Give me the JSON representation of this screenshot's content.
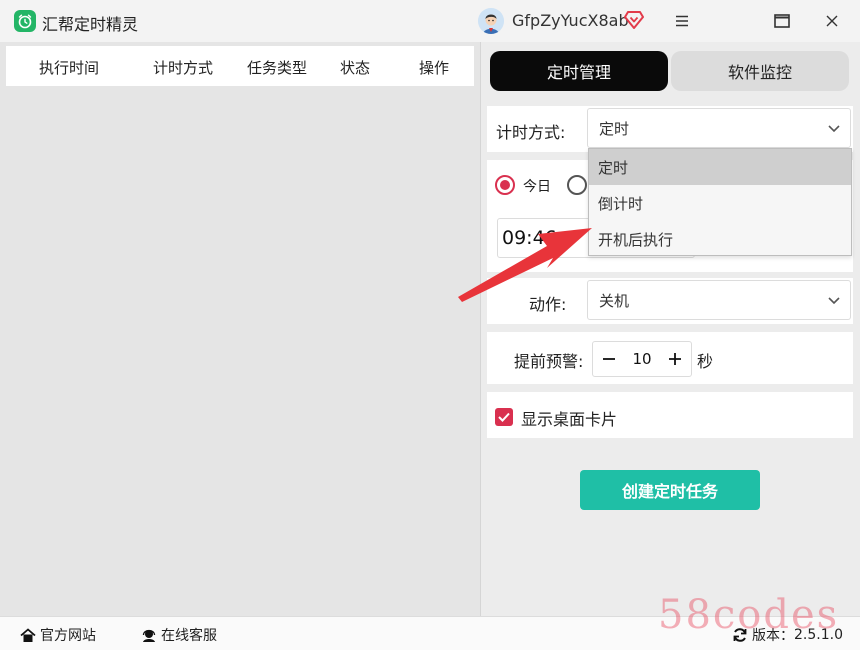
{
  "app": {
    "title": "汇帮定时精灵",
    "username": "GfpZyYucX8ab"
  },
  "colors": {
    "accent_red": "#d9304f",
    "brand_green": "#23b566",
    "create_teal": "#1fbfa6",
    "active_tab": "#0a0a0a",
    "arrow_red": "#e8343a"
  },
  "icons": {
    "logo": "alarm-clock-icon",
    "vip": "diamond-icon",
    "menu": "hamburger-menu-icon",
    "maximize": "maximize-icon",
    "close": "close-icon",
    "home": "home-icon",
    "support": "headset-icon",
    "refresh": "refresh-icon"
  },
  "table": {
    "columns": [
      "执行时间",
      "计时方式",
      "任务类型",
      "状态",
      "操作"
    ]
  },
  "tabs": [
    {
      "label": "定时管理",
      "active": true
    },
    {
      "label": "软件监控",
      "active": false
    }
  ],
  "form": {
    "timing_label": "计时方式:",
    "timing_value": "定时",
    "timing_options": [
      "定时",
      "倒计时",
      "开机后执行"
    ],
    "day_options": [
      "今日"
    ],
    "time_value": "09:46",
    "action_label": "动作:",
    "action_value": "关机",
    "warning_label": "提前预警:",
    "warning_value": "10",
    "warning_unit": "秒",
    "show_card_label": "显示桌面卡片",
    "show_card_checked": true,
    "create_button": "创建定时任务"
  },
  "statusbar": {
    "website": "官方网站",
    "support": "在线客服",
    "version_label": "版本：",
    "version": "2.5.1.0"
  },
  "watermark": "58codes"
}
